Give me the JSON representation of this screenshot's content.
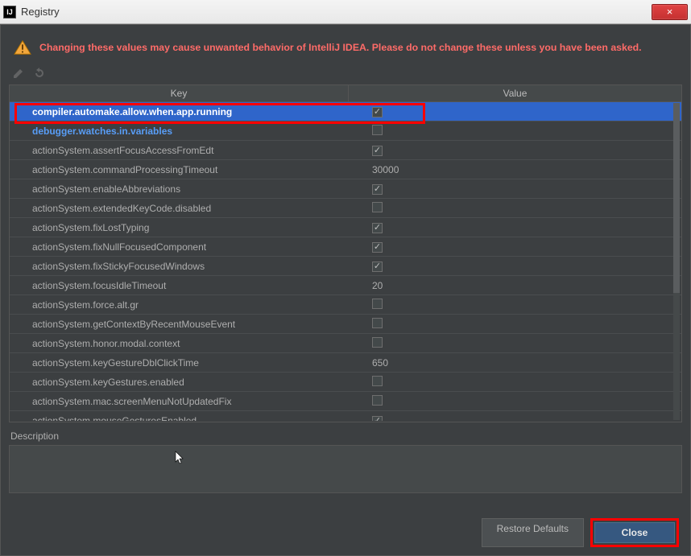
{
  "window": {
    "title": "Registry",
    "close_glyph": "×"
  },
  "warning": {
    "text": "Changing these values may cause unwanted behavior of IntelliJ IDEA. Please do not change these unless you have been asked."
  },
  "columns": {
    "key": "Key",
    "value": "Value"
  },
  "rows": [
    {
      "key": "compiler.automake.allow.when.app.running",
      "type": "bool",
      "checked": true,
      "modified": true,
      "selected": true
    },
    {
      "key": "debugger.watches.in.variables",
      "type": "bool",
      "checked": false,
      "modified": true,
      "selected": false
    },
    {
      "key": "actionSystem.assertFocusAccessFromEdt",
      "type": "bool",
      "checked": true,
      "modified": false,
      "selected": false
    },
    {
      "key": "actionSystem.commandProcessingTimeout",
      "type": "text",
      "value": "30000",
      "modified": false,
      "selected": false
    },
    {
      "key": "actionSystem.enableAbbreviations",
      "type": "bool",
      "checked": true,
      "modified": false,
      "selected": false
    },
    {
      "key": "actionSystem.extendedKeyCode.disabled",
      "type": "bool",
      "checked": false,
      "modified": false,
      "selected": false
    },
    {
      "key": "actionSystem.fixLostTyping",
      "type": "bool",
      "checked": true,
      "modified": false,
      "selected": false
    },
    {
      "key": "actionSystem.fixNullFocusedComponent",
      "type": "bool",
      "checked": true,
      "modified": false,
      "selected": false
    },
    {
      "key": "actionSystem.fixStickyFocusedWindows",
      "type": "bool",
      "checked": true,
      "modified": false,
      "selected": false
    },
    {
      "key": "actionSystem.focusIdleTimeout",
      "type": "text",
      "value": "20",
      "modified": false,
      "selected": false
    },
    {
      "key": "actionSystem.force.alt.gr",
      "type": "bool",
      "checked": false,
      "modified": false,
      "selected": false
    },
    {
      "key": "actionSystem.getContextByRecentMouseEvent",
      "type": "bool",
      "checked": false,
      "modified": false,
      "selected": false
    },
    {
      "key": "actionSystem.honor.modal.context",
      "type": "bool",
      "checked": false,
      "modified": false,
      "selected": false
    },
    {
      "key": "actionSystem.keyGestureDblClickTime",
      "type": "text",
      "value": "650",
      "modified": false,
      "selected": false
    },
    {
      "key": "actionSystem.keyGestures.enabled",
      "type": "bool",
      "checked": false,
      "modified": false,
      "selected": false
    },
    {
      "key": "actionSystem.mac.screenMenuNotUpdatedFix",
      "type": "bool",
      "checked": false,
      "modified": false,
      "selected": false
    },
    {
      "key": "actionSystem.mouseGesturesEnabled",
      "type": "bool",
      "checked": true,
      "modified": false,
      "selected": false
    }
  ],
  "description": {
    "label": "Description"
  },
  "buttons": {
    "restore": "Restore Defaults",
    "close": "Close"
  }
}
